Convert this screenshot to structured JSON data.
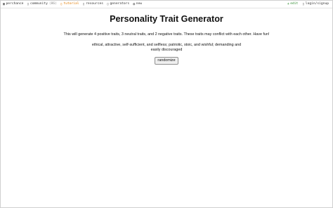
{
  "nav": {
    "left": [
      {
        "icon": "cube-icon",
        "glyph": "▣",
        "label": "perchance",
        "sub": ""
      },
      {
        "icon": "chat-icon",
        "glyph": "▯",
        "label": "community",
        "sub": "(86)"
      },
      {
        "icon": "book-icon",
        "glyph": "▯",
        "label": "tutorial",
        "sub": ""
      },
      {
        "icon": "document-icon",
        "glyph": "▯",
        "label": "resources",
        "sub": ""
      },
      {
        "icon": "grid-icon",
        "glyph": "▯",
        "label": "generators",
        "sub": ""
      },
      {
        "icon": "globe-icon",
        "glyph": "◍",
        "label": "new",
        "sub": ""
      }
    ],
    "right": [
      {
        "icon": "plus-icon",
        "glyph": "+",
        "label": "edit"
      },
      {
        "icon": "user-icon",
        "glyph": "▯",
        "label": "login/signup"
      }
    ],
    "colors": {
      "tutorial": "#e07b00",
      "edit": "#2e8b2e"
    }
  },
  "page": {
    "title": "Personality Trait Generator",
    "description": "This will generate 4 positive traits, 3 neutral traits, and 2 negative traits. These traits may conflict with each other. Have fun!",
    "result_line1": "ethical, attractive, self-sufficient, and selfless; patriotic, stoic, and wishful; demanding and",
    "result_line2": "easily discouraged",
    "button_label": "randomize"
  }
}
